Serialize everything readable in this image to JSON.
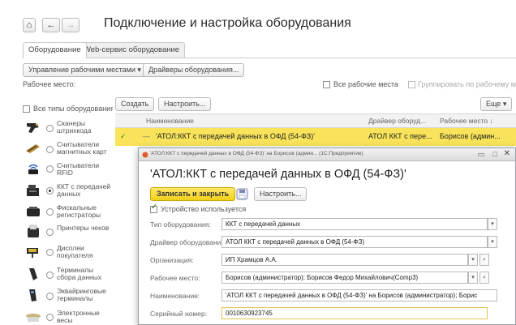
{
  "nav": {
    "home": "⌂",
    "back": "←",
    "forward": "→"
  },
  "title": "Подключение и настройка оборудования",
  "tabs": [
    "Оборудование",
    "Web-сервис оборудование"
  ],
  "toolbar": {
    "workplaces_btn": "Управление рабочими местами ▾",
    "drivers_btn": "Драйверы оборудования...",
    "workplace_label": "Рабочее место:",
    "all_workplaces": "Все рабочие места",
    "group_by_workplace": "Группировать по рабочему месту"
  },
  "left": {
    "all_types": "Все типы оборудования",
    "devices": [
      {
        "label": "Сканеры штрихкода",
        "icon": "barcode-scanner-icon"
      },
      {
        "label": "Считыватели магнитных карт",
        "icon": "card-reader-icon"
      },
      {
        "label": "Считыватели RFID",
        "icon": "rfid-reader-icon"
      },
      {
        "label": "ККТ с передачей данных",
        "icon": "cash-register-icon",
        "selected": true
      },
      {
        "label": "Фискальные регистраторы",
        "icon": "fiscal-printer-icon"
      },
      {
        "label": "Принтеры чеков",
        "icon": "receipt-printer-icon"
      },
      {
        "label": "Дисплеи покупателя",
        "icon": "customer-display-icon"
      },
      {
        "label": "Терминалы сбора данных",
        "icon": "data-terminal-icon"
      },
      {
        "label": "Эквайринговые терминалы",
        "icon": "pos-terminal-icon"
      },
      {
        "label": "Электронные весы",
        "icon": "scale-icon"
      }
    ]
  },
  "table": {
    "create_btn": "Создать",
    "configure_btn": "Настроить...",
    "more_btn": "Еще ▾",
    "columns": [
      "Наименование",
      "Драйвер оборуд...",
      "Рабочее место ↓"
    ],
    "row": {
      "check": "✓",
      "name": "'АТОЛ:ККТ с передачей данных в ОФД (54-ФЗ)'",
      "driver": "АТОЛ ККТ с пере...",
      "workplace": "Борисов (админ..."
    }
  },
  "dialog": {
    "titlebar": "'АТОЛ:ККТ с передачей данных в ОФД (54-ФЗ)' на Борисов (админ... (1С:Предприятие)",
    "heading": "'АТОЛ:ККТ с передачей данных в ОФД (54-ФЗ)'",
    "save_close": "Записать и закрыть",
    "configure": "Настроить...",
    "device_used": "Устройство используется",
    "fields": [
      {
        "label": "Тип оборудования:",
        "value": "ККТ с передачей данных"
      },
      {
        "label": "Драйвер оборудования:",
        "value": "АТОЛ ККТ с передачей данных в ОФД (54-ФЗ)"
      },
      {
        "label": "Организация:",
        "value": "ИП Храмцов А.А."
      },
      {
        "label": "Рабочее место:",
        "value": "Борисов (администратор); Борисов Федор Михайлович(Comp3)"
      },
      {
        "label": "Наименование:",
        "value": "'АТОЛ ККТ с передачей данных в ОФД (54-ФЗ)' на Борисов (администратор); Борис"
      },
      {
        "label": "Серийный номер:",
        "value": "0010630923745"
      }
    ]
  },
  "colors": {
    "highlight": "#f8e35a",
    "accent_btn": "#f2cf18"
  }
}
